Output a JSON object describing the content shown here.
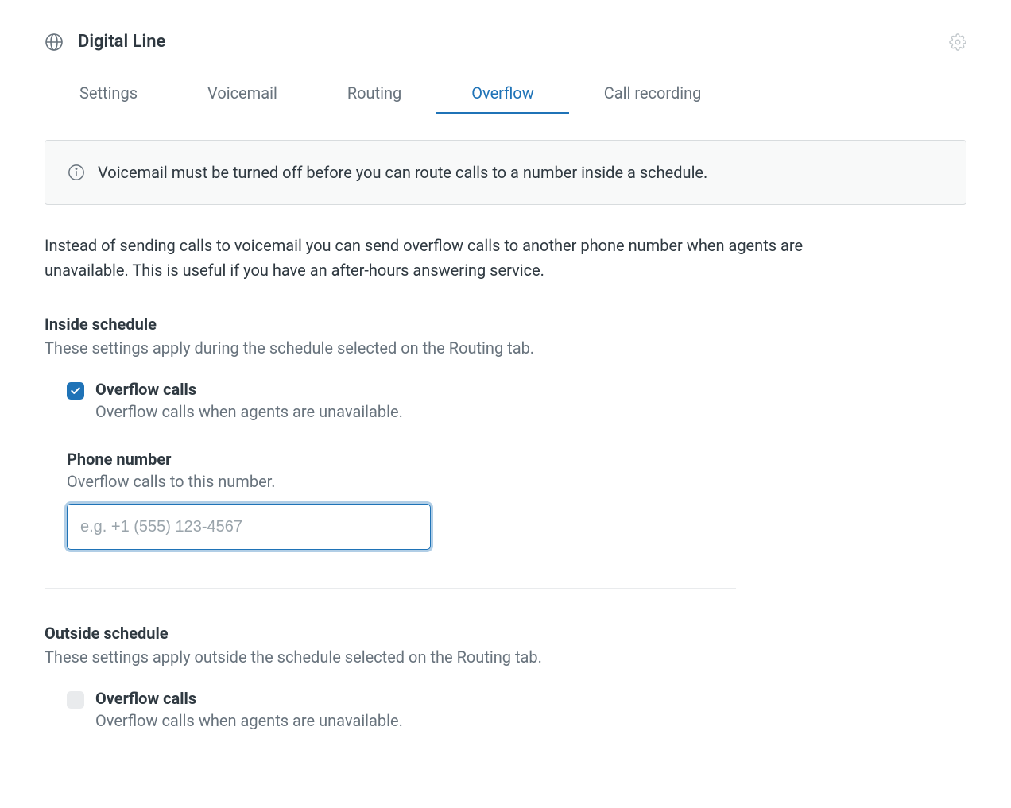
{
  "header": {
    "title": "Digital Line"
  },
  "tabs": [
    {
      "label": "Settings",
      "active": false
    },
    {
      "label": "Voicemail",
      "active": false
    },
    {
      "label": "Routing",
      "active": false
    },
    {
      "label": "Overflow",
      "active": true
    },
    {
      "label": "Call recording",
      "active": false
    }
  ],
  "info_banner": "Voicemail must be turned off before you can route calls to a number inside a schedule.",
  "intro": "Instead of sending calls to voicemail you can send overflow calls to another phone number when agents are unavailable. This is useful if you have an after-hours answering service.",
  "inside_schedule": {
    "title": "Inside schedule",
    "subtitle": "These settings apply during the schedule selected on the Routing tab.",
    "overflow_checkbox": {
      "checked": true,
      "label": "Overflow calls",
      "desc": "Overflow calls when agents are unavailable."
    },
    "phone_field": {
      "label": "Phone number",
      "desc": "Overflow calls to this number.",
      "placeholder": "e.g. +1 (555) 123-4567",
      "value": ""
    }
  },
  "outside_schedule": {
    "title": "Outside schedule",
    "subtitle": "These settings apply outside the schedule selected on the Routing tab.",
    "overflow_checkbox": {
      "checked": false,
      "label": "Overflow calls",
      "desc": "Overflow calls when agents are unavailable."
    }
  }
}
